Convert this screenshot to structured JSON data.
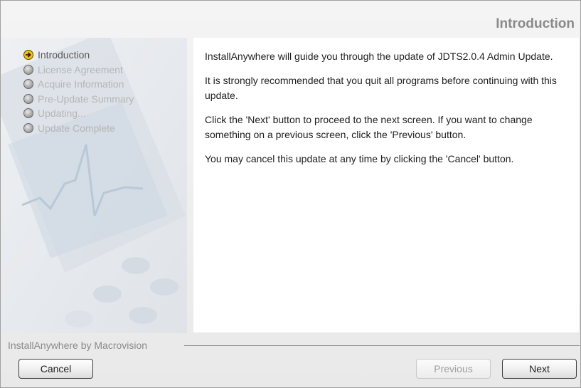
{
  "header": {
    "title": "Introduction"
  },
  "steps": [
    {
      "label": "Introduction",
      "state": "current"
    },
    {
      "label": "License Agreement",
      "state": "pending"
    },
    {
      "label": "Acquire Information",
      "state": "pending"
    },
    {
      "label": "Pre-Update Summary",
      "state": "pending"
    },
    {
      "label": "Updating...",
      "state": "pending"
    },
    {
      "label": "Update Complete",
      "state": "pending"
    }
  ],
  "content": {
    "paragraphs": [
      "InstallAnywhere will guide you through the update of JDTS2.0.4 Admin Update.",
      "It is strongly recommended that you quit all programs before continuing with this update.",
      "Click the 'Next' button to proceed to the next screen. If you want to change something on a previous screen, click the 'Previous' button.",
      "You may cancel this update at any time by clicking the 'Cancel' button."
    ]
  },
  "footer": {
    "vendor": "InstallAnywhere by Macrovision",
    "cancel_label": "Cancel",
    "previous_label": "Previous",
    "next_label": "Next"
  },
  "colors": {
    "current_step": "#f2c40c",
    "content_bg": "#ffffff",
    "header_text": "#8a8a8a"
  }
}
